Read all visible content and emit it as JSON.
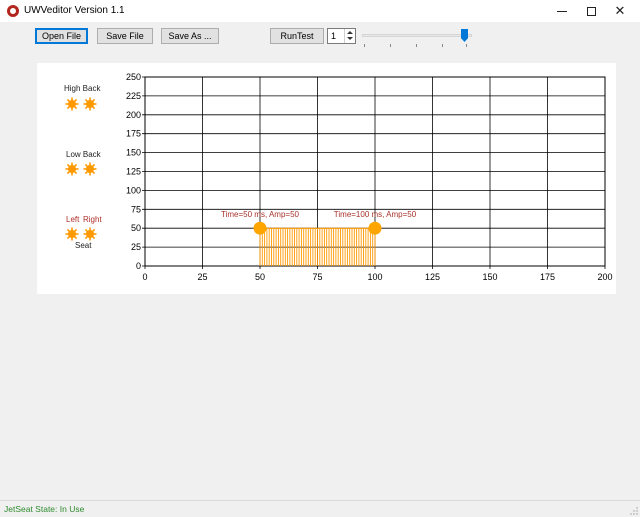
{
  "window": {
    "title": "UWVeditor  Version 1.1",
    "minimize_icon": "minimize-icon",
    "maximize_icon": "maximize-icon",
    "close_icon": "close-icon",
    "close_glyph": "✕"
  },
  "toolbar": {
    "open_label": "Open File",
    "save_label": "Save File",
    "saveas_label": "Save As ...",
    "run_label": "RunTest",
    "stepper_value": "1",
    "slider_level": 0.92
  },
  "seat": {
    "high_back_label": "High Back",
    "low_back_label": "Low Back",
    "left_label": "Left",
    "right_label": "Right",
    "seat_label": "Seat",
    "sun_color": "#ff9900"
  },
  "chart_data": {
    "type": "bar",
    "x_ticks": [
      0,
      25,
      50,
      75,
      100,
      125,
      150,
      175,
      200
    ],
    "y_ticks": [
      0,
      25,
      50,
      75,
      100,
      125,
      150,
      175,
      200,
      225,
      250
    ],
    "xlim": [
      0,
      200
    ],
    "ylim": [
      0,
      250
    ],
    "grid": true,
    "pulse": {
      "start": 50,
      "end": 100,
      "amplitude": 50,
      "step": 1
    },
    "points": [
      {
        "x": 50,
        "y": 50,
        "label": "Time=50 ms, Amp=50"
      },
      {
        "x": 100,
        "y": 50,
        "label": "Time=100 ms, Amp=50"
      }
    ],
    "bar_color": "#ff9900",
    "point_color": "#ffa500",
    "label_color": "#a8332b"
  },
  "status": {
    "text": "JetSeat State: In Use",
    "color": "#2e8b2e"
  }
}
